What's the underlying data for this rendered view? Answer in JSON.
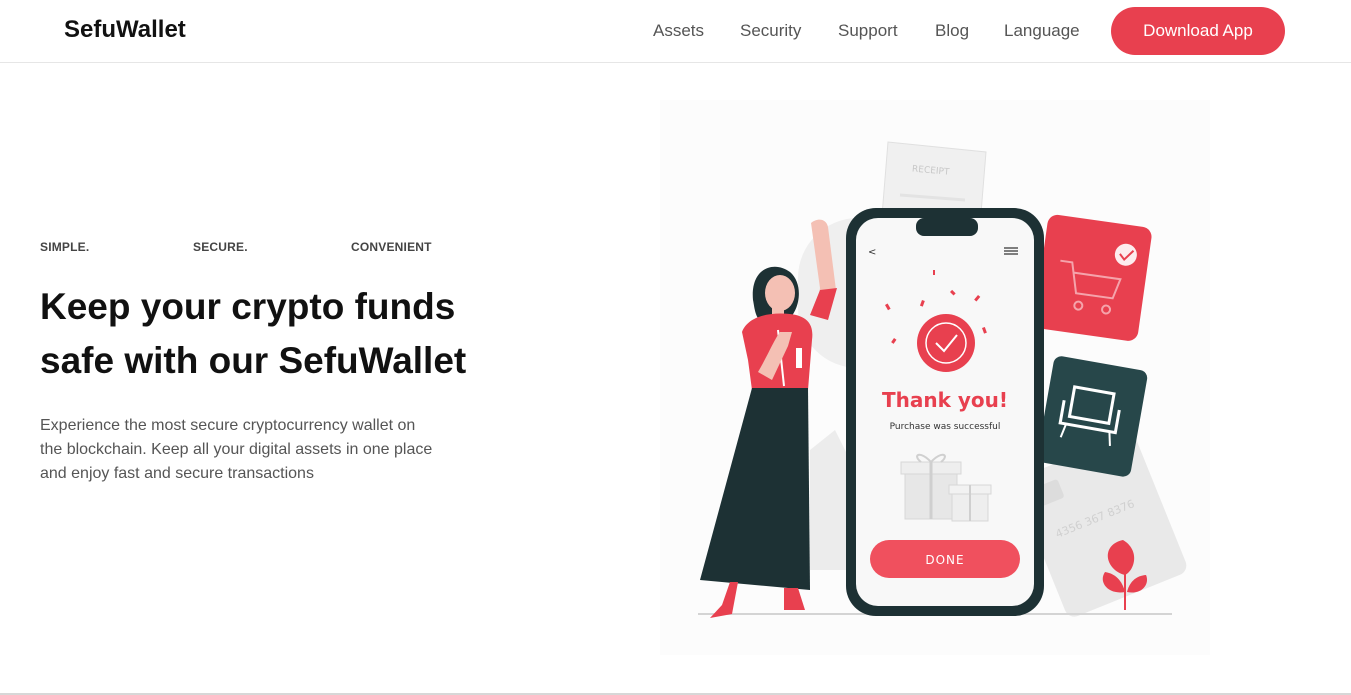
{
  "brand": "SefuWallet",
  "nav": {
    "links": [
      "Assets",
      "Security",
      "Support",
      "Blog",
      "Language"
    ],
    "cta": "Download App"
  },
  "hero": {
    "tags": [
      "SIMPLE.",
      "SECURE.",
      "CONVENIENT"
    ],
    "headline_line1": "Keep your crypto funds",
    "headline_line2": "safe with our SefuWallet",
    "description": "Experience the most secure cryptocurrency wallet on the blockchain. Keep all your digital assets in one place and enjoy fast and secure transactions"
  },
  "illustration": {
    "receipt_text": "RECEIPT",
    "title": "Thank you!",
    "subtitle": "Purchase was successful",
    "button": "DONE",
    "card_number": "4356 367 8376"
  },
  "colors": {
    "accent": "#e8404f",
    "dark": "#1d3134",
    "teal_card": "#27474a"
  }
}
